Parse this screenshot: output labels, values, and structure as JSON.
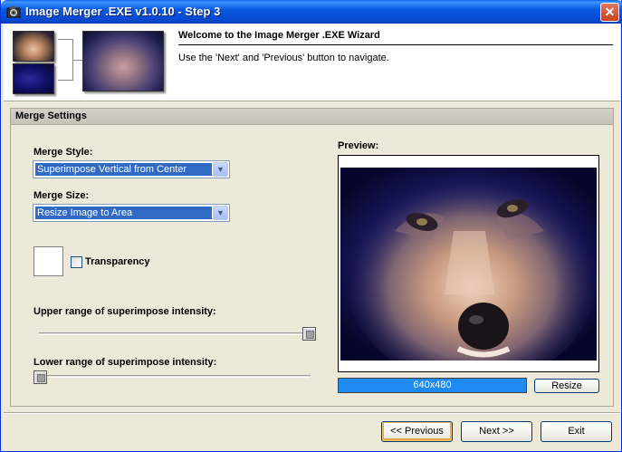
{
  "window": {
    "title": "Image Merger .EXE v1.0.10 - Step 3",
    "close_label": "✕"
  },
  "header": {
    "title": "Welcome to the Image Merger .EXE Wizard",
    "subtitle": "Use the 'Next' and 'Previous' button to navigate."
  },
  "group": {
    "title": "Merge Settings"
  },
  "merge_style": {
    "label": "Merge Style:",
    "value": "Superimpose Vertical from Center"
  },
  "merge_size": {
    "label": "Merge Size:",
    "value": "Resize Image to Area"
  },
  "transparency": {
    "label": "Transparency",
    "checked": false
  },
  "upper_range": {
    "label": "Upper range of superimpose intensity:",
    "level": 1.0
  },
  "lower_range": {
    "label": "Lower range of superimpose intensity:",
    "level": 0.0
  },
  "preview": {
    "label": "Preview:",
    "dimensions": "640x480",
    "resize_label": "Resize"
  },
  "nav": {
    "previous_label": "<< Previous",
    "next_label": "Next >>",
    "exit_label": "Exit"
  }
}
